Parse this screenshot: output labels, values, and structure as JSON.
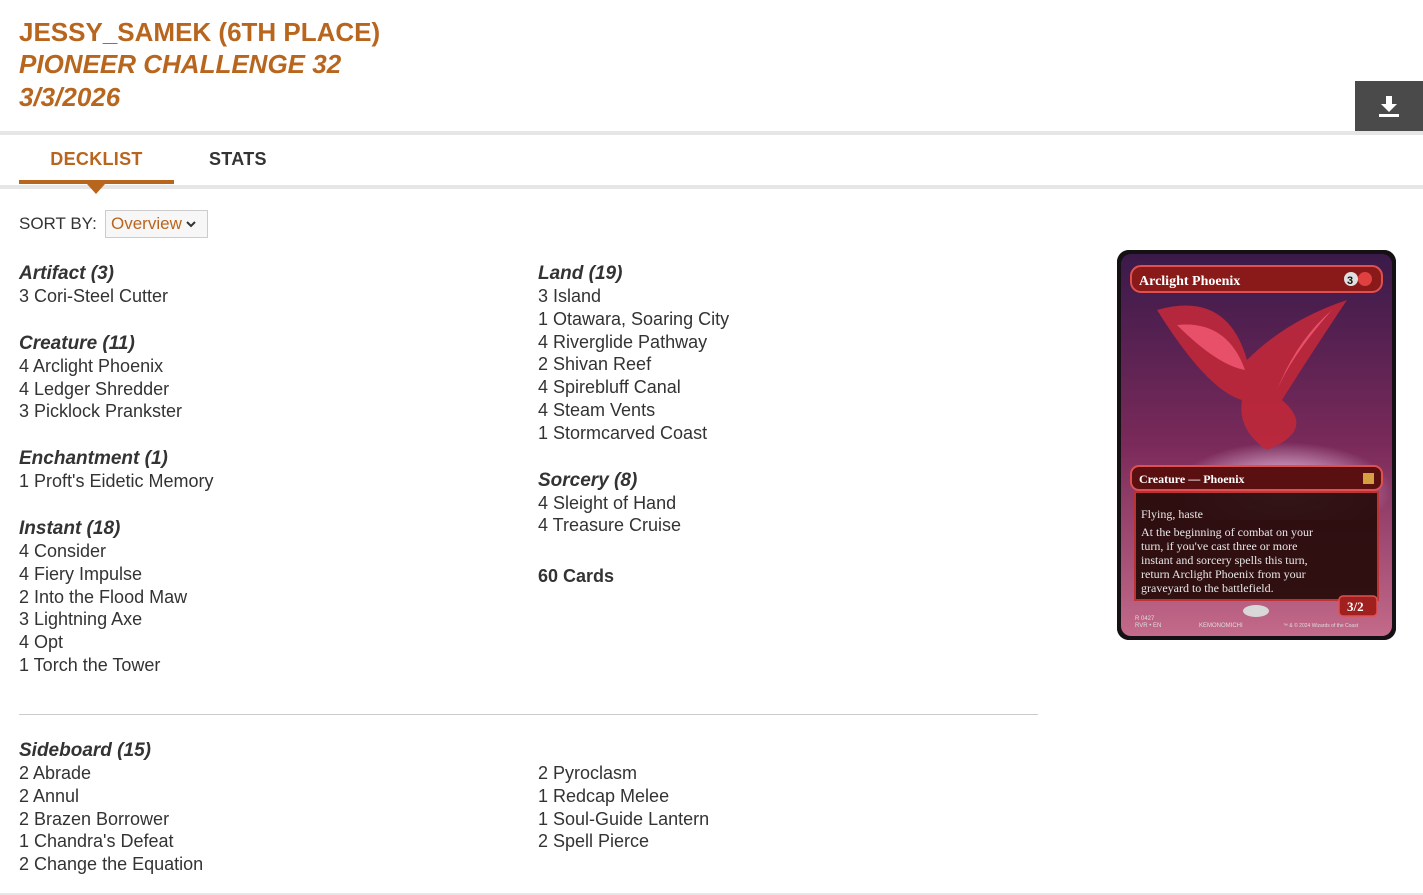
{
  "header": {
    "player": "JESSY_SAMEK (6TH PLACE)",
    "event": "PIONEER CHALLENGE 32",
    "date": "3/3/2026"
  },
  "tabs": [
    {
      "label": "DECKLIST",
      "active": true
    },
    {
      "label": "STATS",
      "active": false
    }
  ],
  "sort": {
    "label": "SORT BY:",
    "selected": "Overview"
  },
  "maindeck": {
    "left": [
      {
        "title": "Artifact (3)",
        "cards": [
          "3 Cori-Steel Cutter"
        ]
      },
      {
        "title": "Creature (11)",
        "cards": [
          "4 Arclight Phoenix",
          "4 Ledger Shredder",
          "3 Picklock Prankster"
        ]
      },
      {
        "title": "Enchantment (1)",
        "cards": [
          "1 Proft's Eidetic Memory"
        ]
      },
      {
        "title": "Instant (18)",
        "cards": [
          "4 Consider",
          "4 Fiery Impulse",
          "2 Into the Flood Maw",
          "3 Lightning Axe",
          "4 Opt",
          "1 Torch the Tower"
        ]
      }
    ],
    "right": [
      {
        "title": "Land (19)",
        "cards": [
          "3 Island",
          "1 Otawara, Soaring City",
          "4 Riverglide Pathway",
          "2 Shivan Reef",
          "4 Spirebluff Canal",
          "4 Steam Vents",
          "1 Stormcarved Coast"
        ]
      },
      {
        "title": "Sorcery (8)",
        "cards": [
          "4 Sleight of Hand",
          "4 Treasure Cruise"
        ]
      }
    ],
    "total": "60 Cards"
  },
  "sideboard": {
    "title": "Sideboard (15)",
    "left": [
      "2 Abrade",
      "2 Annul",
      "2 Brazen Borrower",
      "1 Chandra's Defeat",
      "2 Change the Equation"
    ],
    "right": [
      "2 Pyroclasm",
      "1 Redcap Melee",
      "1 Soul-Guide Lantern",
      "2 Spell Pierce"
    ]
  },
  "card_preview": {
    "name": "Arclight Phoenix",
    "mana_cost": "3",
    "type_line": "Creature — Phoenix",
    "rules_1": "Flying, haste",
    "rules_2": "At the beginning of combat on your turn, if you've cast three or more instant and sorcery spells this turn, return Arclight Phoenix from your graveyard to the battlefield.",
    "pt": "3/2",
    "collector": "R 0427",
    "set_line": "RVR • EN",
    "artist": "KEMONOMICHI",
    "copyright": "™ & © 2024 Wizards of the Coast",
    "colors": {
      "frame": "#c62b2b",
      "accent": "#b8651e"
    }
  },
  "icons": {
    "download": "download-icon",
    "dropdown": "chevron-down-icon"
  }
}
